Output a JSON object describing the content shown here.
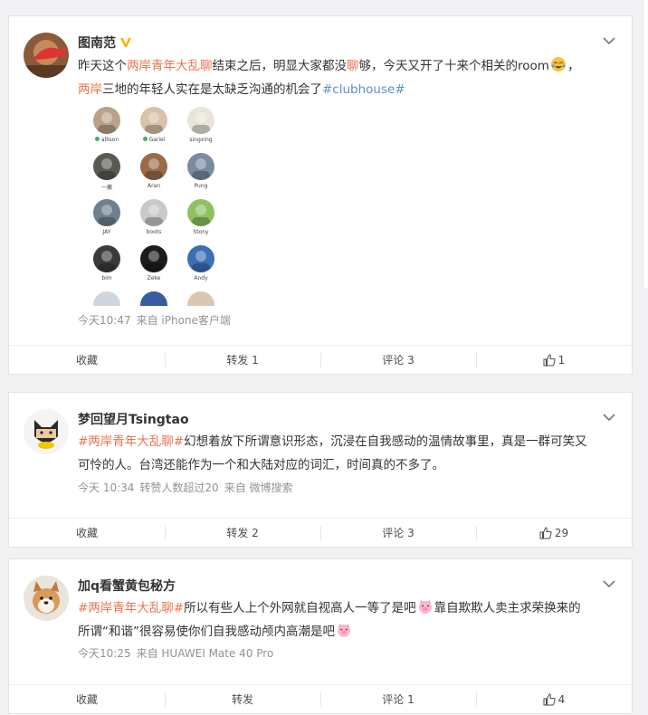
{
  "posts": [
    {
      "user": "图南范",
      "verified": true,
      "text_a": "昨天这个",
      "topic_link": "两岸青年大乱聊",
      "text_b": "结束之后，明显大家都没",
      "text_c": "聊",
      "text_d": "够，今天又开了十来个相关的room",
      "text_e": "，",
      "text_f": "两岸",
      "text_g": "三地的年轻人实在是太缺乏沟通的机会了",
      "hashtag": "#clubhouse#",
      "members": [
        {
          "name": "allison",
          "dot": true
        },
        {
          "name": "Gariel",
          "dot": true
        },
        {
          "name": "singxing",
          "dot": false
        },
        {
          "name": "一撇",
          "dot": false
        },
        {
          "name": "Aran",
          "dot": false
        },
        {
          "name": "Pung",
          "dot": false
        },
        {
          "name": "JAY",
          "dot": false
        },
        {
          "name": "boots",
          "dot": false
        },
        {
          "name": "Stony",
          "dot": false
        },
        {
          "name": "bim",
          "dot": false
        },
        {
          "name": "Zeke",
          "dot": false
        },
        {
          "name": "Andy",
          "dot": false
        }
      ],
      "time": "今天10:47",
      "source": "来自 iPhone客户端",
      "actions": {
        "fav": "收藏",
        "repost": "转发 1",
        "comment": "评论 3",
        "like": "1"
      }
    },
    {
      "user": "梦回望月Tsingtao",
      "hashtag": "#两岸青年大乱聊#",
      "text_line1": "幻想着放下所谓意识形态，沉浸在自我感动的温情故事里，真是一群可笑又",
      "text_line2": "可怜的人。台湾还能作为一个和大陆对应的词汇，时间真的不多了。",
      "time": "今天 10:34",
      "extra": "转赞人数超过20",
      "source": "来自 微博搜索",
      "actions": {
        "fav": "收藏",
        "repost": "转发 2",
        "comment": "评论 3",
        "like": "29"
      }
    },
    {
      "user": "加q看蟹黄包秘方",
      "hashtag": "#两岸青年大乱聊#",
      "text_a": "所以有些人上个外网就自视高人一等了是吧",
      "text_b": "靠自欺欺人卖主求荣换来的",
      "text_c": "所谓“和谐”很容易使你们自我感动颅内高潮是吧",
      "time": "今天10:25",
      "source": "来自 HUAWEI Mate 40 Pro",
      "actions": {
        "fav": "收藏",
        "repost": "转发",
        "comment": "评论 1",
        "like": "4"
      }
    }
  ],
  "colors": {
    "topic": "#eb7350",
    "meta": "#939393",
    "bg": "#f2f2f5"
  }
}
